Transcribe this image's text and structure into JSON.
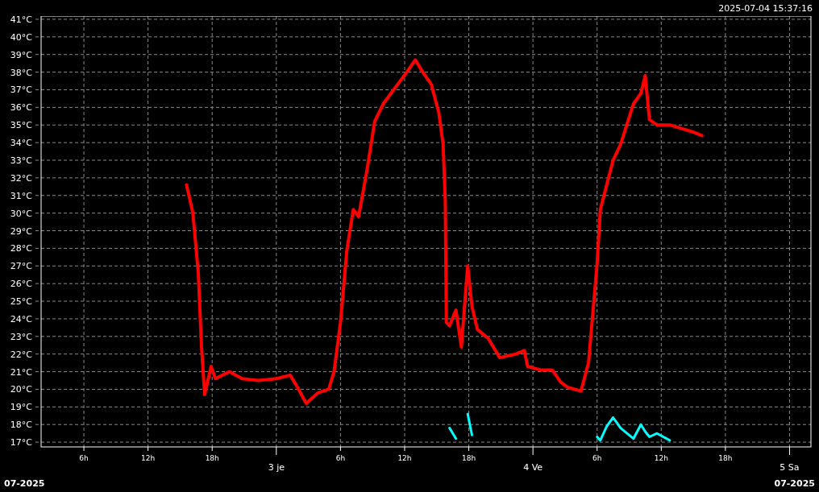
{
  "chart": {
    "timestamp": "2025-07-04 15:37:16",
    "chart_data": {
      "type": "line",
      "grid": true,
      "x": [
        "2025-07-02T15:36",
        "2025-07-02T16:12",
        "2025-07-02T16:42",
        "2025-07-02T17:00",
        "2025-07-02T17:18",
        "2025-07-02T17:54",
        "2025-07-02T18:18",
        "2025-07-02T19:36",
        "2025-07-02T20:48",
        "2025-07-02T22:18",
        "2025-07-03T00:00",
        "2025-07-03T01:18",
        "2025-07-03T01:54",
        "2025-07-03T02:48",
        "2025-07-03T03:54",
        "2025-07-03T04:54",
        "2025-07-03T05:24",
        "2025-07-03T06:00",
        "2025-07-03T06:36",
        "2025-07-03T07:12",
        "2025-07-03T07:42",
        "2025-07-03T08:30",
        "2025-07-03T09:12",
        "2025-07-03T10:00",
        "2025-07-03T11:06",
        "2025-07-03T12:12",
        "2025-07-03T13:00",
        "2025-07-03T13:42",
        "2025-07-03T14:30",
        "2025-07-03T15:12",
        "2025-07-03T15:36",
        "2025-07-03T15:48",
        "2025-07-03T15:54",
        "2025-07-03T16:12",
        "2025-07-03T16:48",
        "2025-07-03T17:18",
        "2025-07-03T17:54",
        "2025-07-03T18:18",
        "2025-07-03T18:48",
        "2025-07-03T19:48",
        "2025-07-03T20:54",
        "2025-07-03T22:24",
        "2025-07-03T23:12",
        "2025-07-03T23:30",
        "2025-07-04T00:42",
        "2025-07-04T01:48",
        "2025-07-04T02:36",
        "2025-07-04T03:18",
        "2025-07-04T04:30",
        "2025-07-04T05:12",
        "2025-07-04T06:00",
        "2025-07-04T06:18",
        "2025-07-04T06:54",
        "2025-07-04T07:30",
        "2025-07-04T08:12",
        "2025-07-04T09:24",
        "2025-07-04T10:06",
        "2025-07-04T10:30",
        "2025-07-04T10:54",
        "2025-07-04T11:36",
        "2025-07-04T12:48",
        "2025-07-04T13:54",
        "2025-07-04T15:00",
        "2025-07-04T15:48"
      ],
      "series": [
        {
          "color": "#ff0000",
          "values": [
            31.6,
            30.0,
            26.6,
            22.4,
            19.7,
            21.3,
            20.6,
            21.0,
            20.6,
            20.5,
            20.6,
            20.8,
            20.2,
            19.2,
            19.8,
            20.0,
            21.0,
            23.8,
            27.9,
            30.2,
            29.8,
            32.5,
            35.2,
            36.2,
            37.1,
            38.0,
            38.7,
            38.0,
            37.3,
            35.7,
            33.9,
            30.7,
            23.8,
            23.6,
            24.5,
            22.4,
            27.0,
            24.7,
            23.4,
            22.9,
            21.8,
            22.0,
            22.2,
            21.3,
            21.1,
            21.1,
            20.4,
            20.1,
            19.9,
            21.5,
            27.1,
            30.2,
            31.6,
            33.0,
            33.9,
            36.2,
            36.8,
            37.8,
            35.3,
            35.0,
            35.0,
            34.8,
            34.6,
            34.4
          ]
        },
        {
          "color": "#00ffff",
          "values": [
            null,
            null,
            null,
            null,
            null,
            null,
            null,
            null,
            null,
            null,
            null,
            null,
            null,
            null,
            null,
            null,
            null,
            null,
            null,
            null,
            null,
            null,
            null,
            null,
            null,
            null,
            null,
            null,
            null,
            null,
            null,
            null,
            null,
            17.8,
            17.2,
            null,
            18.6,
            17.4,
            null,
            null,
            null,
            null,
            null,
            null,
            null,
            null,
            null,
            null,
            null,
            null,
            17.3,
            17.1,
            17.9,
            18.4,
            17.8,
            17.2,
            18.0,
            17.6,
            17.3,
            17.5,
            17.1,
            null,
            null,
            null
          ]
        }
      ],
      "xlim": [
        "2025-07-02T02:00",
        "2025-07-05T02:00"
      ],
      "ylim": [
        16.73,
        41.18
      ],
      "xticks": [
        {
          "value": "2025-07-02T06:00",
          "label": "6h"
        },
        {
          "value": "2025-07-02T12:00",
          "label": "12h"
        },
        {
          "value": "2025-07-02T18:00",
          "label": "18h"
        },
        {
          "value": "2025-07-03T06:00",
          "label": "6h"
        },
        {
          "value": "2025-07-03T12:00",
          "label": "12h"
        },
        {
          "value": "2025-07-03T18:00",
          "label": "18h"
        },
        {
          "value": "2025-07-04T06:00",
          "label": "6h"
        },
        {
          "value": "2025-07-04T12:00",
          "label": "12h"
        },
        {
          "value": "2025-07-04T18:00",
          "label": "18h"
        }
      ],
      "yticks": [
        {
          "value": 17,
          "label": "17°C"
        },
        {
          "value": 18,
          "label": "18°C"
        },
        {
          "value": 19,
          "label": "19°C"
        },
        {
          "value": 20,
          "label": "20°C"
        },
        {
          "value": 21,
          "label": "21°C"
        },
        {
          "value": 22,
          "label": "22°C"
        },
        {
          "value": 23,
          "label": "23°C"
        },
        {
          "value": 24,
          "label": "24°C"
        },
        {
          "value": 25,
          "label": "25°C"
        },
        {
          "value": 26,
          "label": "26°C"
        },
        {
          "value": 27,
          "label": "27°C"
        },
        {
          "value": 28,
          "label": "28°C"
        },
        {
          "value": 29,
          "label": "29°C"
        },
        {
          "value": 30,
          "label": "30°C"
        },
        {
          "value": 31,
          "label": "31°C"
        },
        {
          "value": 32,
          "label": "32°C"
        },
        {
          "value": 33,
          "label": "33°C"
        },
        {
          "value": 34,
          "label": "34°C"
        },
        {
          "value": 35,
          "label": "35°C"
        },
        {
          "value": 36,
          "label": "36°C"
        },
        {
          "value": 37,
          "label": "37°C"
        },
        {
          "value": 38,
          "label": "38°C"
        },
        {
          "value": 39,
          "label": "39°C"
        },
        {
          "value": 40,
          "label": "40°C"
        },
        {
          "value": 41,
          "label": "41°C"
        }
      ]
    },
    "day_labels": [
      "3 je",
      "4 Ve",
      "5 Sa"
    ]
  },
  "footer": {
    "left_label": "07-2025",
    "right_label": "07-2025"
  }
}
